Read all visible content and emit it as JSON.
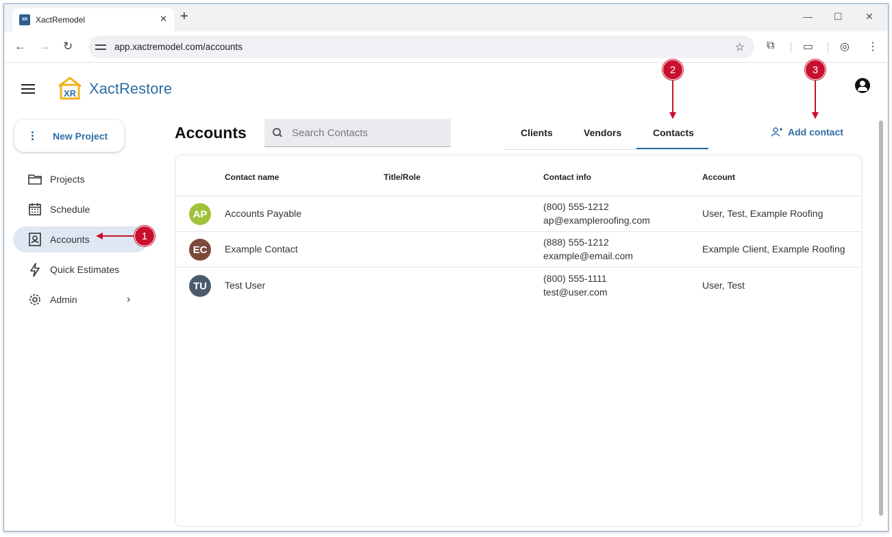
{
  "browser": {
    "tab_title": "XactRemodel",
    "tab_close": "✕",
    "new_tab": "+",
    "url": "app.xactremodel.com/accounts",
    "window_controls": [
      "—",
      "☐",
      "✕"
    ]
  },
  "app": {
    "brand": "XactRestore",
    "logo_mark": "XR"
  },
  "sidebar": {
    "new_project": "New Project",
    "items": [
      {
        "label": "Projects",
        "icon": "folder-icon"
      },
      {
        "label": "Schedule",
        "icon": "calendar-icon"
      },
      {
        "label": "Accounts",
        "icon": "contact-card-icon",
        "active": true
      },
      {
        "label": "Quick Estimates",
        "icon": "lightning-icon"
      },
      {
        "label": "Admin",
        "icon": "gear-icon"
      }
    ]
  },
  "main": {
    "title": "Accounts",
    "search_placeholder": "Search Contacts",
    "tabs": [
      "Clients",
      "Vendors",
      "Contacts"
    ],
    "active_tab": "Contacts",
    "add_contact": "Add contact",
    "columns": [
      "Contact name",
      "Title/Role",
      "Contact info",
      "Account"
    ],
    "rows": [
      {
        "initials": "AP",
        "color": "#a0c23a",
        "name": "Accounts Payable",
        "role": "",
        "phone": "(800) 555-1212",
        "email": "ap@exampleroofing.com",
        "account": "User, Test, Example Roofing"
      },
      {
        "initials": "EC",
        "color": "#7b4a3a",
        "name": "Example Contact",
        "role": "",
        "phone": "(888) 555-1212",
        "email": "example@email.com",
        "account": "Example Client, Example Roofing"
      },
      {
        "initials": "TU",
        "color": "#4a5a6d",
        "name": "Test User",
        "role": "",
        "phone": "(800) 555-1111",
        "email": "test@user.com",
        "account": "User, Test"
      }
    ]
  },
  "annotations": [
    "1",
    "2",
    "3"
  ],
  "colors": {
    "accent": "#2e6da4",
    "annotation": "#c8102e"
  }
}
